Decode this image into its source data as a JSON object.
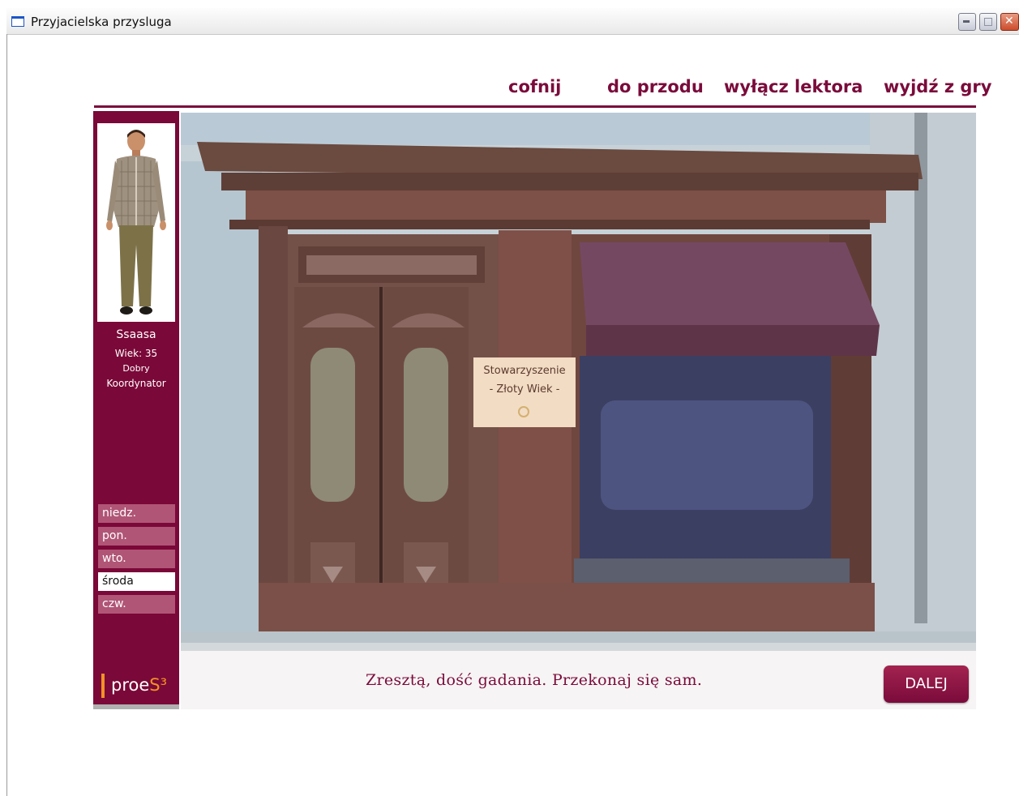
{
  "window": {
    "title": "Przyjacielska przysluga"
  },
  "nav": {
    "back": "cofnij",
    "forward": "do przodu",
    "narrator_off": "wyłącz lektora",
    "exit": "wyjdź z gry"
  },
  "profile": {
    "name": "Ssaasa",
    "age": "Wiek: 35",
    "status": "Dobry",
    "role": "Koordynator"
  },
  "days": [
    {
      "label": "niedz.",
      "active": false
    },
    {
      "label": "pon.",
      "active": false
    },
    {
      "label": "wto.",
      "active": false
    },
    {
      "label": "środa",
      "active": true
    },
    {
      "label": "czw.",
      "active": false
    }
  ],
  "logo": {
    "text": "proe",
    "accent": "S³"
  },
  "scene": {
    "sign_line1": "Stowarzyszenie",
    "sign_line2": "- Złoty Wiek -"
  },
  "dialog": {
    "text": "Zresztą, dość gadania. Przekonaj się sam."
  },
  "next_button": "DALEJ",
  "colors": {
    "accent": "#7a0b3b",
    "day_inactive": "#b05576",
    "logo_orange": "#f29126"
  }
}
